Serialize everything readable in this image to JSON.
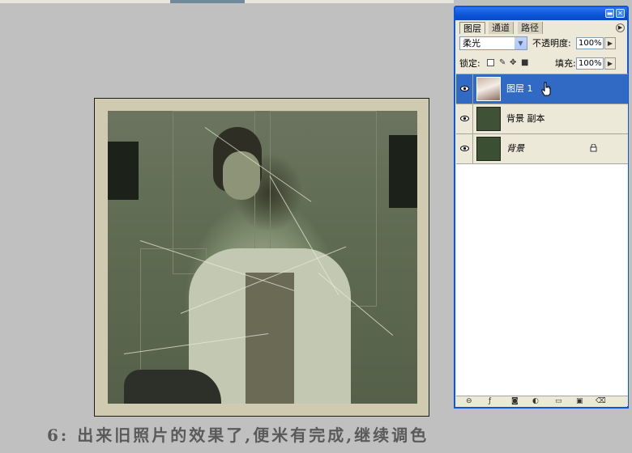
{
  "caption": "6: 出来旧照片的效果了,便米有完成,继续调色",
  "palette": {
    "tabs": [
      "图层",
      "通道",
      "路径"
    ],
    "active_tab": 0,
    "blend_mode": "柔光",
    "opacity_label": "不透明度:",
    "opacity_value": "100%",
    "lock_label": "锁定:",
    "fill_label": "填充:",
    "fill_value": "100%",
    "layers": [
      {
        "name": "图层 1",
        "selected": true,
        "visible": true,
        "locked": false
      },
      {
        "name": "背景 副本",
        "selected": false,
        "visible": true,
        "locked": false
      },
      {
        "name": "背景",
        "selected": false,
        "visible": true,
        "locked": true
      }
    ],
    "bottom_icons": [
      "link-icon",
      "layer-style-icon",
      "mask-icon",
      "adjustment-layer-icon",
      "group-folder-icon",
      "new-layer-icon",
      "trash-icon"
    ]
  },
  "colors": {
    "palette_border": "#0a58e0",
    "selection": "#316ac5",
    "background": "#c0c0c0",
    "caption": "#5a5a5a"
  }
}
